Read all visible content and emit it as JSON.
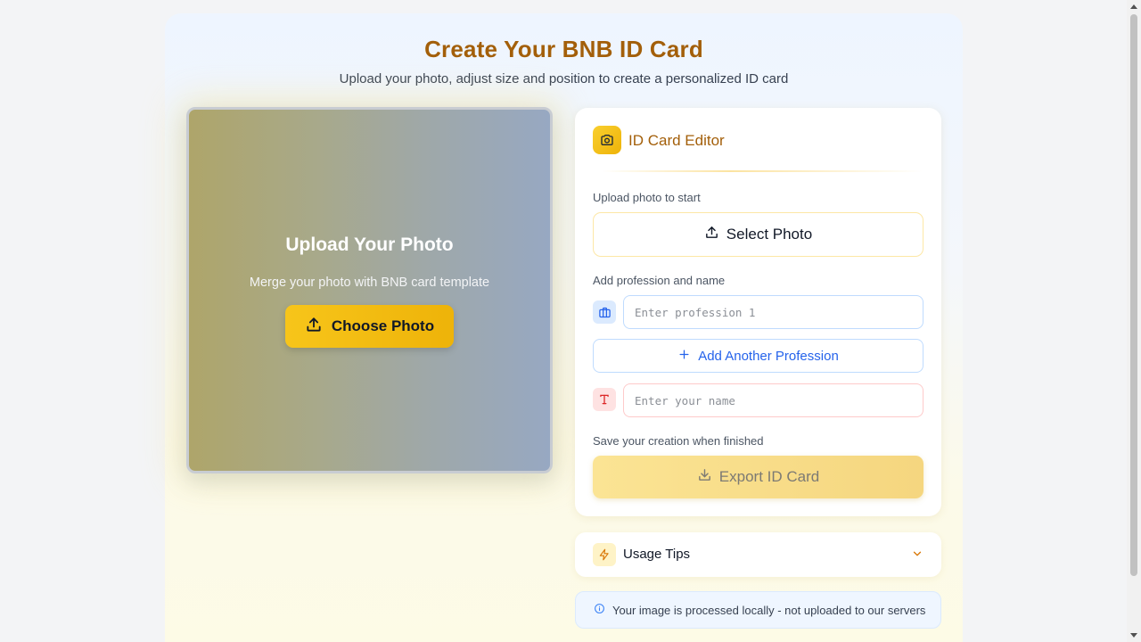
{
  "header": {
    "title": "Create Your BNB ID Card",
    "subtitle": "Upload your photo, adjust size and position to create a personalized ID card"
  },
  "preview": {
    "title": "Upload Your Photo",
    "subtitle": "Merge your photo with BNB card template",
    "choose_button": "Choose Photo",
    "icon": "upload-icon"
  },
  "editor": {
    "title": "ID Card Editor",
    "header_icon": "camera-icon",
    "upload_label": "Upload photo to start",
    "select_button": "Select Photo",
    "profession_label": "Add profession and name",
    "profession_placeholder": "Enter profession 1",
    "add_profession_button": "Add Another Profession",
    "name_placeholder": "Enter your name",
    "save_label": "Save your creation when finished",
    "export_button": "Export ID Card"
  },
  "tips": {
    "label": "Usage Tips",
    "icon": "lightning-icon"
  },
  "notice": {
    "text": "Your image is processed locally - not uploaded to our servers",
    "icon": "info-icon"
  },
  "colors": {
    "brand_gold": "#eeb309",
    "title_brown": "#a35f0a",
    "link_blue": "#2563eb"
  }
}
